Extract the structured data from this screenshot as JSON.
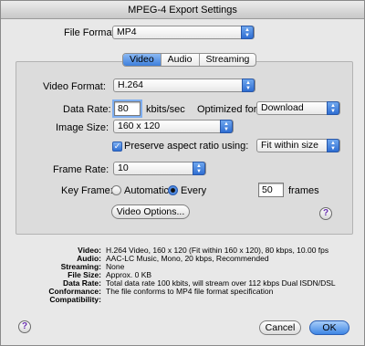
{
  "window": {
    "title": "MPEG-4 Export Settings"
  },
  "file_format": {
    "label": "File Format:",
    "value": "MP4"
  },
  "tabs": [
    {
      "label": "Video",
      "active": true
    },
    {
      "label": "Audio",
      "active": false
    },
    {
      "label": "Streaming",
      "active": false
    }
  ],
  "video": {
    "format_label": "Video Format:",
    "format_value": "H.264",
    "data_rate_label": "Data Rate:",
    "data_rate_value": "80",
    "data_rate_unit": "kbits/sec",
    "optimized_label": "Optimized for:",
    "optimized_value": "Download",
    "image_size_label": "Image Size:",
    "image_size_value": "160 x 120",
    "preserve_label": "Preserve aspect ratio using:",
    "preserve_checked": true,
    "preserve_value": "Fit within size",
    "frame_rate_label": "Frame Rate:",
    "frame_rate_value": "10",
    "key_frame_label": "Key Frame:",
    "automatic_label": "Automatic",
    "every_label": "Every",
    "key_frame_value": "50",
    "frames_label": "frames",
    "options_button": "Video Options..."
  },
  "summary": [
    {
      "key": "Video:",
      "value": "H.264 Video, 160 x 120 (Fit within 160 x 120), 80 kbps, 10.00 fps"
    },
    {
      "key": "Audio:",
      "value": "AAC-LC Music, Mono, 20 kbps, Recommended"
    },
    {
      "key": "Streaming:",
      "value": "None"
    },
    {
      "key": "File Size:",
      "value": "Approx. 0 KB"
    },
    {
      "key": "Data Rate:",
      "value": "Total data rate 100 kbits, will stream over 112 kbps Dual ISDN/DSL"
    },
    {
      "key": "Conformance:",
      "value": "The file conforms to MP4 file format specification"
    },
    {
      "key": "Compatibility:",
      "value": ""
    }
  ],
  "buttons": {
    "cancel": "Cancel",
    "ok": "OK",
    "help": "?"
  },
  "colors": {
    "accent": "#3e86e4",
    "help_glyph": "#6a2fb0"
  }
}
